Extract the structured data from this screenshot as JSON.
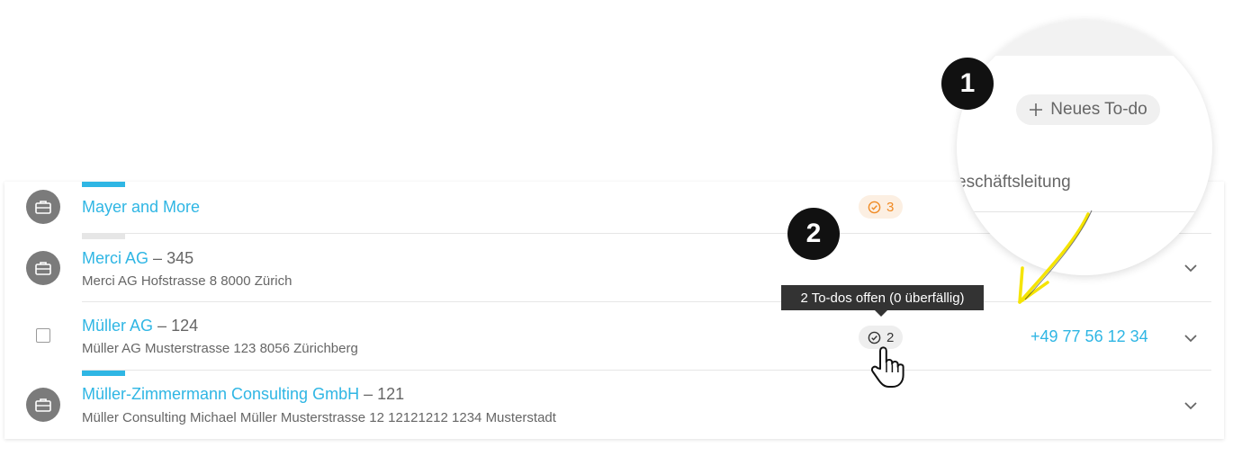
{
  "rows": [
    {
      "name": "Mayer and More",
      "sep": "",
      "number": "",
      "address": "",
      "todo_count": "3",
      "phone": ""
    },
    {
      "name": "Merci AG",
      "sep": "–",
      "number": "345",
      "address": "Merci AG Hofstrasse 8 8000 Zürich",
      "todo_count": "",
      "phone": ""
    },
    {
      "name": "Müller AG",
      "sep": "–",
      "number": "124",
      "address": "Müller AG Musterstrasse 123 8056 Zürichberg",
      "todo_count": "2",
      "phone": "+49 77 56 12 34"
    },
    {
      "name": "Müller-Zimmermann Consulting GmbH",
      "sep": "–",
      "number": "121",
      "address": "Müller Consulting Michael Müller Musterstrasse 12 12121212 1234 Musterstadt",
      "todo_count": "",
      "phone": ""
    }
  ],
  "tooltip": "2 To-dos offen (0 überfällig)",
  "badges": {
    "one": "1",
    "two": "2"
  },
  "magnifier": {
    "button_label": "Neues To-do",
    "text": "eschäftsleitung"
  },
  "colors": {
    "link": "#2fb6e4",
    "todo_orange": "#f08a23",
    "badge": "#111111",
    "arrow": "#f5e400"
  },
  "icons": {
    "company": "briefcase-icon",
    "todo": "check-circle-icon",
    "expand": "chevron-down-icon",
    "add": "plus-icon",
    "pointer": "hand-cursor-icon"
  }
}
